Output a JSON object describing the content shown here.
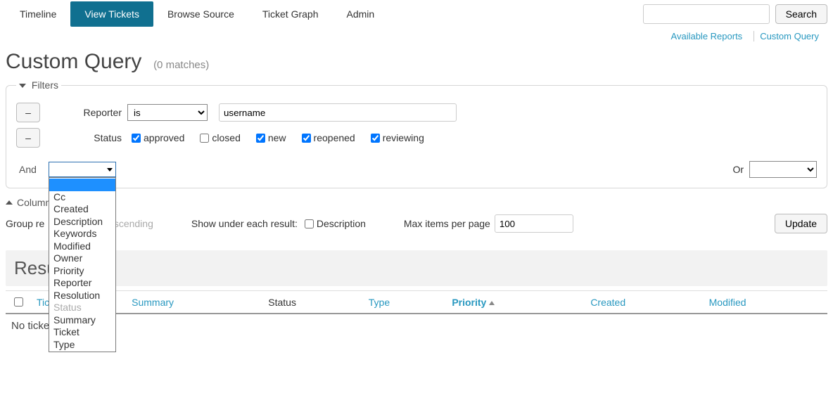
{
  "nav": {
    "tabs": [
      "Timeline",
      "View Tickets",
      "Browse Source",
      "Ticket Graph",
      "Admin"
    ],
    "active": "View Tickets",
    "search_button": "Search"
  },
  "subnav": {
    "available_reports": "Available Reports",
    "custom_query": "Custom Query"
  },
  "title": {
    "heading": "Custom Query",
    "match_count": "(0 matches)"
  },
  "filters": {
    "legend": "Filters",
    "reporter": {
      "label": "Reporter",
      "operator": "is",
      "value": "username"
    },
    "status": {
      "label": "Status",
      "options": [
        {
          "label": "approved",
          "checked": true
        },
        {
          "label": "closed",
          "checked": false
        },
        {
          "label": "new",
          "checked": true
        },
        {
          "label": "reopened",
          "checked": true
        },
        {
          "label": "reviewing",
          "checked": true
        }
      ]
    },
    "and_label": "And",
    "or_label": "Or",
    "dropdown_items": [
      {
        "label": "",
        "selected": true
      },
      {
        "label": "Cc"
      },
      {
        "label": "Created"
      },
      {
        "label": "Description"
      },
      {
        "label": "Keywords"
      },
      {
        "label": "Modified"
      },
      {
        "label": "Owner"
      },
      {
        "label": "Priority"
      },
      {
        "label": "Reporter"
      },
      {
        "label": "Resolution"
      },
      {
        "label": "Status",
        "disabled": true
      },
      {
        "label": "Summary"
      },
      {
        "label": "Ticket"
      },
      {
        "label": "Type"
      }
    ]
  },
  "columns_legend": "Columns",
  "options": {
    "group_label": "Group results by",
    "descending_label": "descending",
    "show_under_label": "Show under each result:",
    "description_label": "Description",
    "max_items_label": "Max items per page",
    "max_items_value": "100",
    "update_label": "Update"
  },
  "results": {
    "heading_prefix": "Resu",
    "columns": {
      "ticket": "Ticket",
      "summary": "Summary",
      "status": "Status",
      "type": "Type",
      "priority": "Priority",
      "created": "Created",
      "modified": "Modified"
    },
    "sort_col": "priority",
    "empty": "No tickets found"
  }
}
